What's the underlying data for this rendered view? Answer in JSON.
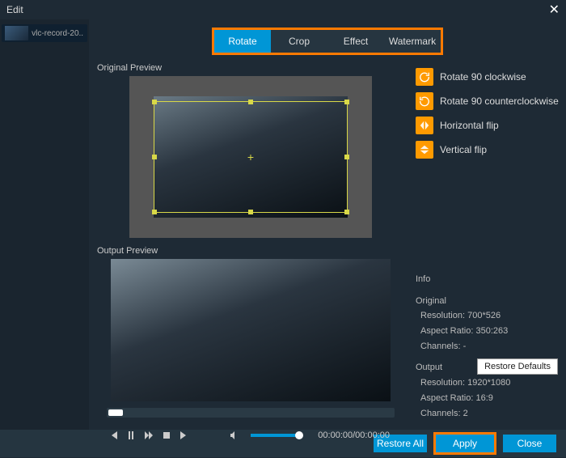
{
  "titlebar": {
    "title": "Edit"
  },
  "sidebar": {
    "clip_name": "vlc-record-20..."
  },
  "tabs": [
    "Rotate",
    "Crop",
    "Effect",
    "Watermark"
  ],
  "active_tab_index": 0,
  "preview": {
    "original_label": "Original Preview",
    "output_label": "Output Preview"
  },
  "options": [
    {
      "label": "Rotate 90 clockwise",
      "icon": "rotate-cw"
    },
    {
      "label": "Rotate 90 counterclockwise",
      "icon": "rotate-ccw"
    },
    {
      "label": "Horizontal flip",
      "icon": "flip-h"
    },
    {
      "label": "Vertical flip",
      "icon": "flip-v"
    }
  ],
  "info": {
    "heading": "Info",
    "original": {
      "label": "Original",
      "resolution_label": "Resolution:",
      "resolution": "700*526",
      "aspect_label": "Aspect Ratio:",
      "aspect": "350:263",
      "channels_label": "Channels:",
      "channels": "-"
    },
    "output": {
      "label": "Output",
      "resolution_label": "Resolution:",
      "resolution": "1920*1080",
      "aspect_label": "Aspect Ratio:",
      "aspect": "16:9",
      "channels_label": "Channels:",
      "channels": "2"
    }
  },
  "transport": {
    "timecode": "00:00:00/00:00:00"
  },
  "buttons": {
    "restore_defaults": "Restore Defaults",
    "restore_all": "Restore All",
    "apply": "Apply",
    "close": "Close"
  }
}
